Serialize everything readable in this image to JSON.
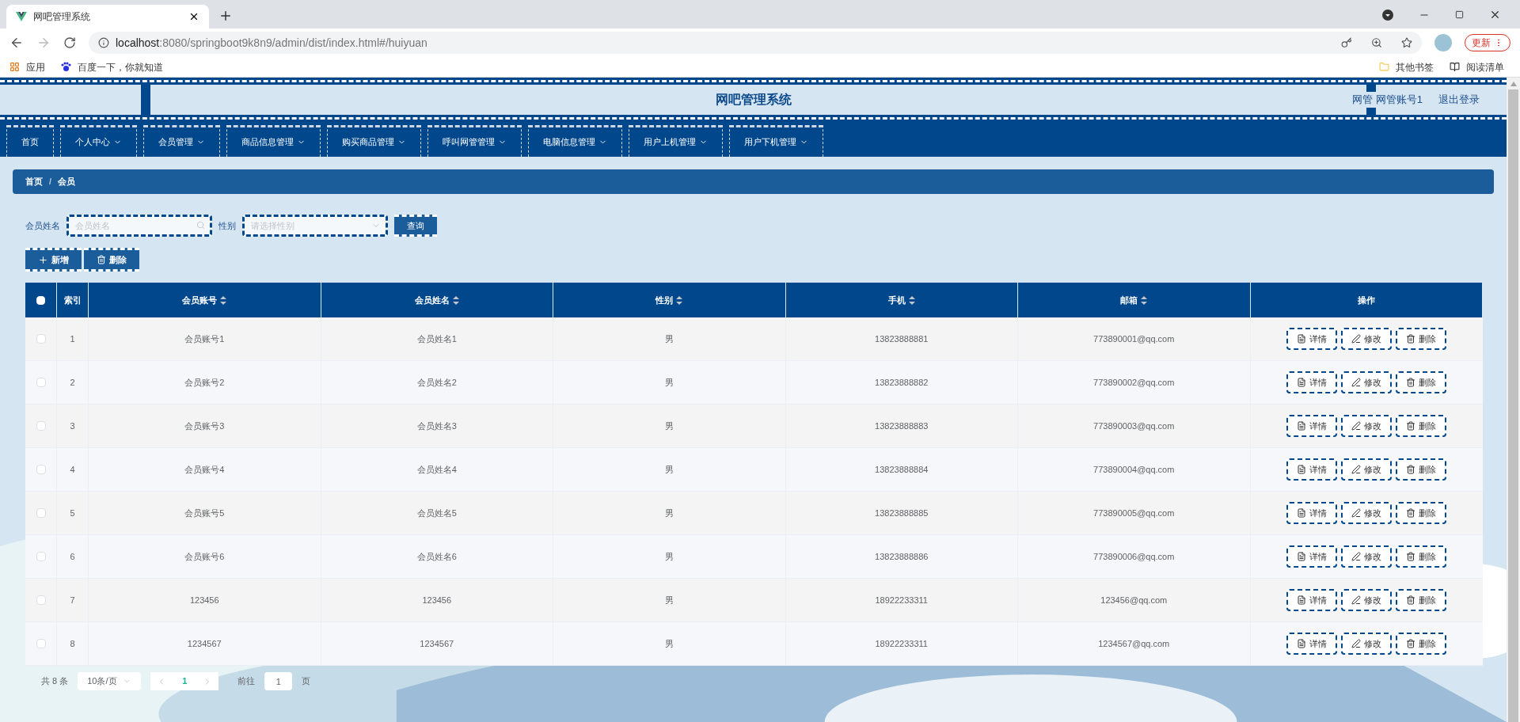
{
  "browser": {
    "tab_title": "网吧管理系统",
    "url_host": "localhost",
    "url_rest": ":8080/springboot9k8n9/admin/dist/index.html#/huiyuan",
    "bookmarks": [
      "应用",
      "百度一下，你就知道"
    ],
    "bookmarks_right": [
      "其他书签",
      "阅读清单"
    ],
    "update_button": "更新"
  },
  "header": {
    "title": "网吧管理系统",
    "role": "网管",
    "user": "网管账号1",
    "logout": "退出登录"
  },
  "nav": [
    {
      "label": "首页",
      "dropdown": false
    },
    {
      "label": "个人中心",
      "dropdown": true
    },
    {
      "label": "会员管理",
      "dropdown": true
    },
    {
      "label": "商品信息管理",
      "dropdown": true
    },
    {
      "label": "购买商品管理",
      "dropdown": true
    },
    {
      "label": "呼叫网管管理",
      "dropdown": true
    },
    {
      "label": "电脑信息管理",
      "dropdown": true
    },
    {
      "label": "用户上机管理",
      "dropdown": true
    },
    {
      "label": "用户下机管理",
      "dropdown": true
    }
  ],
  "breadcrumb": {
    "items": [
      "首页",
      "会员"
    ],
    "separator": "/"
  },
  "search": {
    "fields": [
      {
        "label": "会员姓名",
        "placeholder": "会员姓名",
        "kind": "text"
      },
      {
        "label": "性别",
        "placeholder": "请选择性别",
        "kind": "select"
      }
    ],
    "button": "查询"
  },
  "actions": [
    {
      "label": "新增",
      "kind": "add"
    },
    {
      "label": "删除",
      "kind": "delete"
    }
  ],
  "table": {
    "header_checked": false,
    "columns": [
      {
        "label": "索引",
        "sortable": false
      },
      {
        "label": "会员账号",
        "sortable": true
      },
      {
        "label": "会员姓名",
        "sortable": true
      },
      {
        "label": "性别",
        "sortable": true
      },
      {
        "label": "手机",
        "sortable": true
      },
      {
        "label": "邮箱",
        "sortable": true
      },
      {
        "label": "操作",
        "sortable": false
      }
    ],
    "rows": [
      {
        "checked": false,
        "cells": [
          "1",
          "会员账号1",
          "会员姓名1",
          "男",
          "13823888881",
          "773890001@qq.com"
        ],
        "actions": [
          {
            "label": "详情",
            "kind": "detail"
          },
          {
            "label": "修改",
            "kind": "edit"
          },
          {
            "label": "删除",
            "kind": "delete"
          }
        ]
      },
      {
        "checked": false,
        "cells": [
          "2",
          "会员账号2",
          "会员姓名2",
          "男",
          "13823888882",
          "773890002@qq.com"
        ],
        "actions": [
          {
            "label": "详情",
            "kind": "detail"
          },
          {
            "label": "修改",
            "kind": "edit"
          },
          {
            "label": "删除",
            "kind": "delete"
          }
        ]
      },
      {
        "checked": false,
        "cells": [
          "3",
          "会员账号3",
          "会员姓名3",
          "男",
          "13823888883",
          "773890003@qq.com"
        ],
        "actions": [
          {
            "label": "详情",
            "kind": "detail"
          },
          {
            "label": "修改",
            "kind": "edit"
          },
          {
            "label": "删除",
            "kind": "delete"
          }
        ]
      },
      {
        "checked": false,
        "cells": [
          "4",
          "会员账号4",
          "会员姓名4",
          "男",
          "13823888884",
          "773890004@qq.com"
        ],
        "actions": [
          {
            "label": "详情",
            "kind": "detail"
          },
          {
            "label": "修改",
            "kind": "edit"
          },
          {
            "label": "删除",
            "kind": "delete"
          }
        ]
      },
      {
        "checked": false,
        "cells": [
          "5",
          "会员账号5",
          "会员姓名5",
          "男",
          "13823888885",
          "773890005@qq.com"
        ],
        "actions": [
          {
            "label": "详情",
            "kind": "detail"
          },
          {
            "label": "修改",
            "kind": "edit"
          },
          {
            "label": "删除",
            "kind": "delete"
          }
        ]
      },
      {
        "checked": false,
        "cells": [
          "6",
          "会员账号6",
          "会员姓名6",
          "男",
          "13823888886",
          "773890006@qq.com"
        ],
        "actions": [
          {
            "label": "详情",
            "kind": "detail"
          },
          {
            "label": "修改",
            "kind": "edit"
          },
          {
            "label": "删除",
            "kind": "delete"
          }
        ]
      },
      {
        "checked": false,
        "cells": [
          "7",
          "123456",
          "123456",
          "男",
          "18922233311",
          "123456@qq.com"
        ],
        "actions": [
          {
            "label": "详情",
            "kind": "detail"
          },
          {
            "label": "修改",
            "kind": "edit"
          },
          {
            "label": "删除",
            "kind": "delete"
          }
        ]
      },
      {
        "checked": false,
        "cells": [
          "8",
          "1234567",
          "1234567",
          "男",
          "18922233311",
          "1234567@qq.com"
        ],
        "actions": [
          {
            "label": "详情",
            "kind": "detail"
          },
          {
            "label": "修改",
            "kind": "edit"
          },
          {
            "label": "删除",
            "kind": "delete"
          }
        ]
      }
    ]
  },
  "pagination": {
    "total": "共 8 条",
    "page_size": "10条/页",
    "pages": [
      {
        "label": "1",
        "selected": true
      }
    ],
    "goto_label": "前往",
    "goto_value": "1",
    "page_unit": "页"
  }
}
